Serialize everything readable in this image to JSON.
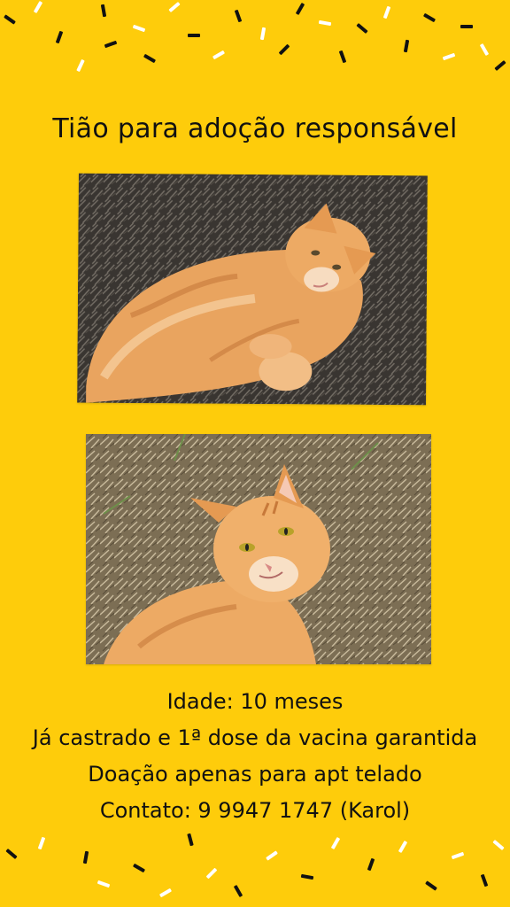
{
  "poster": {
    "title": "Tião para adoção responsável",
    "background_color": "#FECC0B",
    "photos": [
      {
        "subject": "orange tabby cat lying on dry grass"
      },
      {
        "subject": "orange tabby cat looking at camera on dry grass"
      }
    ],
    "info": {
      "age": "Idade: 10 meses",
      "health": "Já castrado e 1ª dose da vacina garantida",
      "condition": "Doação apenas para apt telado",
      "contact": "Contato: 9 9947 1747 (Karol)"
    }
  }
}
